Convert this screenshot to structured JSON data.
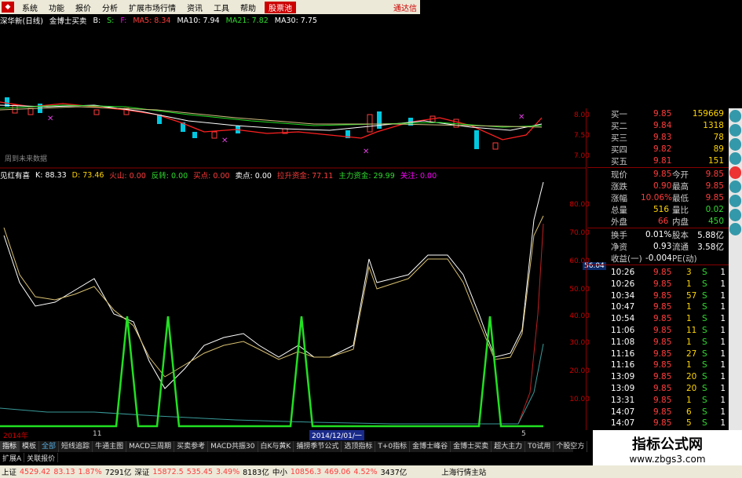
{
  "menu": {
    "items": [
      "系统",
      "功能",
      "报价",
      "分析",
      "扩展市场行情",
      "资讯",
      "工具",
      "帮助"
    ],
    "hot": "股票池",
    "brand": "通达信"
  },
  "ma_line": {
    "stock": "深华新(日线)",
    "indicator": "金博士买卖",
    "b": "B:",
    "s": "S:",
    "f": "F:",
    "ma5": "MA5: 8.34",
    "ma10": "MA10: 7.94",
    "ma21": "MA21: 7.82",
    "ma30": "MA30: 7.75"
  },
  "note": "周到未来数据",
  "ind_line": {
    "name": "见红有喜",
    "k": "K: 88.33",
    "d": "D: 73.46",
    "hs": "火山: 0.00",
    "fz": "反转: 0.00",
    "md": "买点: 0.00",
    "mc": "卖点: 0.00",
    "lsz": "拉升资金: 77.11",
    "zl": "主力资金: 29.99",
    "gz": "关注: 0.00"
  },
  "price_axis": [
    "8.00",
    "7.50",
    "7.00"
  ],
  "ind_axis": [
    "80.00",
    "70.00",
    "60.00",
    "50.00",
    "40.00",
    "30.00",
    "20.00",
    "10.00"
  ],
  "axis_marker": "56.04",
  "bid_ask": [
    {
      "label": "买一",
      "price": "9.85",
      "vol": "159669"
    },
    {
      "label": "买二",
      "price": "9.84",
      "vol": "1318"
    },
    {
      "label": "买三",
      "price": "9.83",
      "vol": "78"
    },
    {
      "label": "买四",
      "price": "9.82",
      "vol": "89"
    },
    {
      "label": "买五",
      "price": "9.81",
      "vol": "151"
    }
  ],
  "quote": [
    {
      "l1": "现价",
      "v1": "9.85",
      "l2": "今开",
      "v2": "9.85"
    },
    {
      "l1": "涨跌",
      "v1": "0.90",
      "l2": "最高",
      "v2": "9.85"
    },
    {
      "l1": "涨幅",
      "v1": "10.06%",
      "l2": "最低",
      "v2": "9.85"
    },
    {
      "l1": "总量",
      "v1": "516",
      "l2": "量比",
      "v2": "0.02"
    },
    {
      "l1": "外盘",
      "v1": "66",
      "l2": "内盘",
      "v2": "450"
    }
  ],
  "stats": [
    {
      "l1": "换手",
      "v1": "0.01%",
      "l2": "股本",
      "v2": "5.88亿"
    },
    {
      "l1": "净资",
      "v1": "0.93",
      "l2": "流通",
      "v2": "3.58亿"
    },
    {
      "l1": "收益(一)",
      "v1": "-0.004",
      "l2": "PE(动)",
      "v2": ""
    }
  ],
  "ticks": [
    {
      "t": "10:26",
      "p": "9.85",
      "v": "3",
      "s": "S",
      "n": "1"
    },
    {
      "t": "10:26",
      "p": "9.85",
      "v": "1",
      "s": "S",
      "n": "1"
    },
    {
      "t": "10:34",
      "p": "9.85",
      "v": "57",
      "s": "S",
      "n": "1"
    },
    {
      "t": "10:47",
      "p": "9.85",
      "v": "1",
      "s": "S",
      "n": "1"
    },
    {
      "t": "10:54",
      "p": "9.85",
      "v": "1",
      "s": "S",
      "n": "1"
    },
    {
      "t": "11:06",
      "p": "9.85",
      "v": "11",
      "s": "S",
      "n": "1"
    },
    {
      "t": "11:08",
      "p": "9.85",
      "v": "1",
      "s": "S",
      "n": "1"
    },
    {
      "t": "11:16",
      "p": "9.85",
      "v": "27",
      "s": "S",
      "n": "1"
    },
    {
      "t": "11:16",
      "p": "9.85",
      "v": "1",
      "s": "S",
      "n": "1"
    },
    {
      "t": "13:09",
      "p": "9.85",
      "v": "20",
      "s": "S",
      "n": "1"
    },
    {
      "t": "13:09",
      "p": "9.85",
      "v": "20",
      "s": "S",
      "n": "1"
    },
    {
      "t": "13:31",
      "p": "9.85",
      "v": "1",
      "s": "S",
      "n": "1"
    },
    {
      "t": "14:07",
      "p": "9.85",
      "v": "6",
      "s": "S",
      "n": "1"
    },
    {
      "t": "14:07",
      "p": "9.85",
      "v": "5",
      "s": "S",
      "n": "1"
    }
  ],
  "date_bar": {
    "left": "2014年",
    "mark": "11",
    "sel": "2014/12/01/一",
    "right": "5"
  },
  "tabs": [
    "指标",
    "模板",
    "全部",
    "短线追踪",
    "牛通主图",
    "MACD三周期",
    "买卖参考",
    "MACD共振30",
    "白K与黄K",
    "捕捞季节公式",
    "选顶指标",
    "T+0指标",
    "金博士峰谷",
    "金博士买卖",
    "超大主力",
    "T0试用",
    "个股空方"
  ],
  "tabs2": [
    "扩展A",
    "关联报价"
  ],
  "status": {
    "sh": "上证",
    "sh_v": "4529.42",
    "sh_c": "83.13",
    "sh_p": "1.87%",
    "sh_a": "7291亿",
    "sz": "深证",
    "sz_v": "15872.5",
    "sz_c": "535.45",
    "sz_p": "3.49%",
    "sz_a": "8183亿",
    "zx": "中小",
    "zx_v": "10856.3",
    "zx_c": "469.06",
    "zx_p": "4.52%",
    "zx_a": "3437亿",
    "site": "上海行情主站"
  },
  "watermark": {
    "t1": "指标公式网",
    "t2": "www.zbgs3.com"
  },
  "colors": {
    "up": "#ff3c3c",
    "down": "#2fdc2f",
    "k": "#ffffff",
    "d": "#d8c070",
    "signal": "#22e022"
  }
}
